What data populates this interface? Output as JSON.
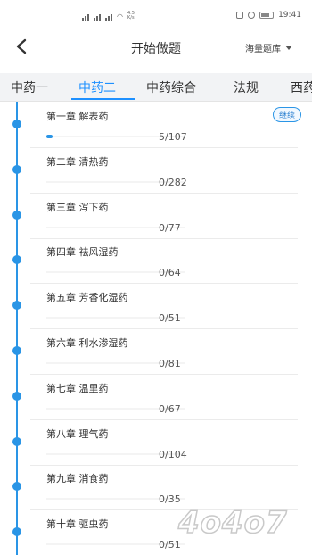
{
  "status_bar": {
    "speed": "4.5\nK/s",
    "time": "19:41",
    "icons": [
      "signal-icon",
      "wifi-icon",
      "nfc-icon",
      "alarm-icon",
      "battery-icon"
    ]
  },
  "header": {
    "title": "开始做题",
    "bank_select": "海量题库",
    "back_icon": "back-arrow-icon"
  },
  "tabs": [
    {
      "label": "中药一",
      "active": false
    },
    {
      "label": "中药二",
      "active": true
    },
    {
      "label": "中药综合",
      "active": false
    },
    {
      "label": "法规",
      "active": false
    },
    {
      "label": "西药",
      "active": false
    }
  ],
  "chapters": [
    {
      "title": "第一章  解表药",
      "done": 5,
      "total": 107,
      "count": "5/107",
      "action": "继续"
    },
    {
      "title": "第二章  清热药",
      "done": 0,
      "total": 282,
      "count": "0/282"
    },
    {
      "title": "第三章  泻下药",
      "done": 0,
      "total": 77,
      "count": "0/77"
    },
    {
      "title": "第四章  祛风湿药",
      "done": 0,
      "total": 64,
      "count": "0/64"
    },
    {
      "title": "第五章  芳香化湿药",
      "done": 0,
      "total": 51,
      "count": "0/51"
    },
    {
      "title": "第六章  利水渗湿药",
      "done": 0,
      "total": 81,
      "count": "0/81"
    },
    {
      "title": "第七章  温里药",
      "done": 0,
      "total": 67,
      "count": "0/67"
    },
    {
      "title": "第八章  理气药",
      "done": 0,
      "total": 104,
      "count": "0/104"
    },
    {
      "title": "第九章  消食药",
      "done": 0,
      "total": 35,
      "count": "0/35"
    },
    {
      "title": "第十章  驱虫药",
      "done": 0,
      "total": 51,
      "count": "0/51"
    }
  ],
  "watermark": "4o4o7",
  "colors": {
    "accent": "#1e90ff",
    "timeline": "#2a95e6",
    "tab_bg": "#f2f3f5"
  }
}
